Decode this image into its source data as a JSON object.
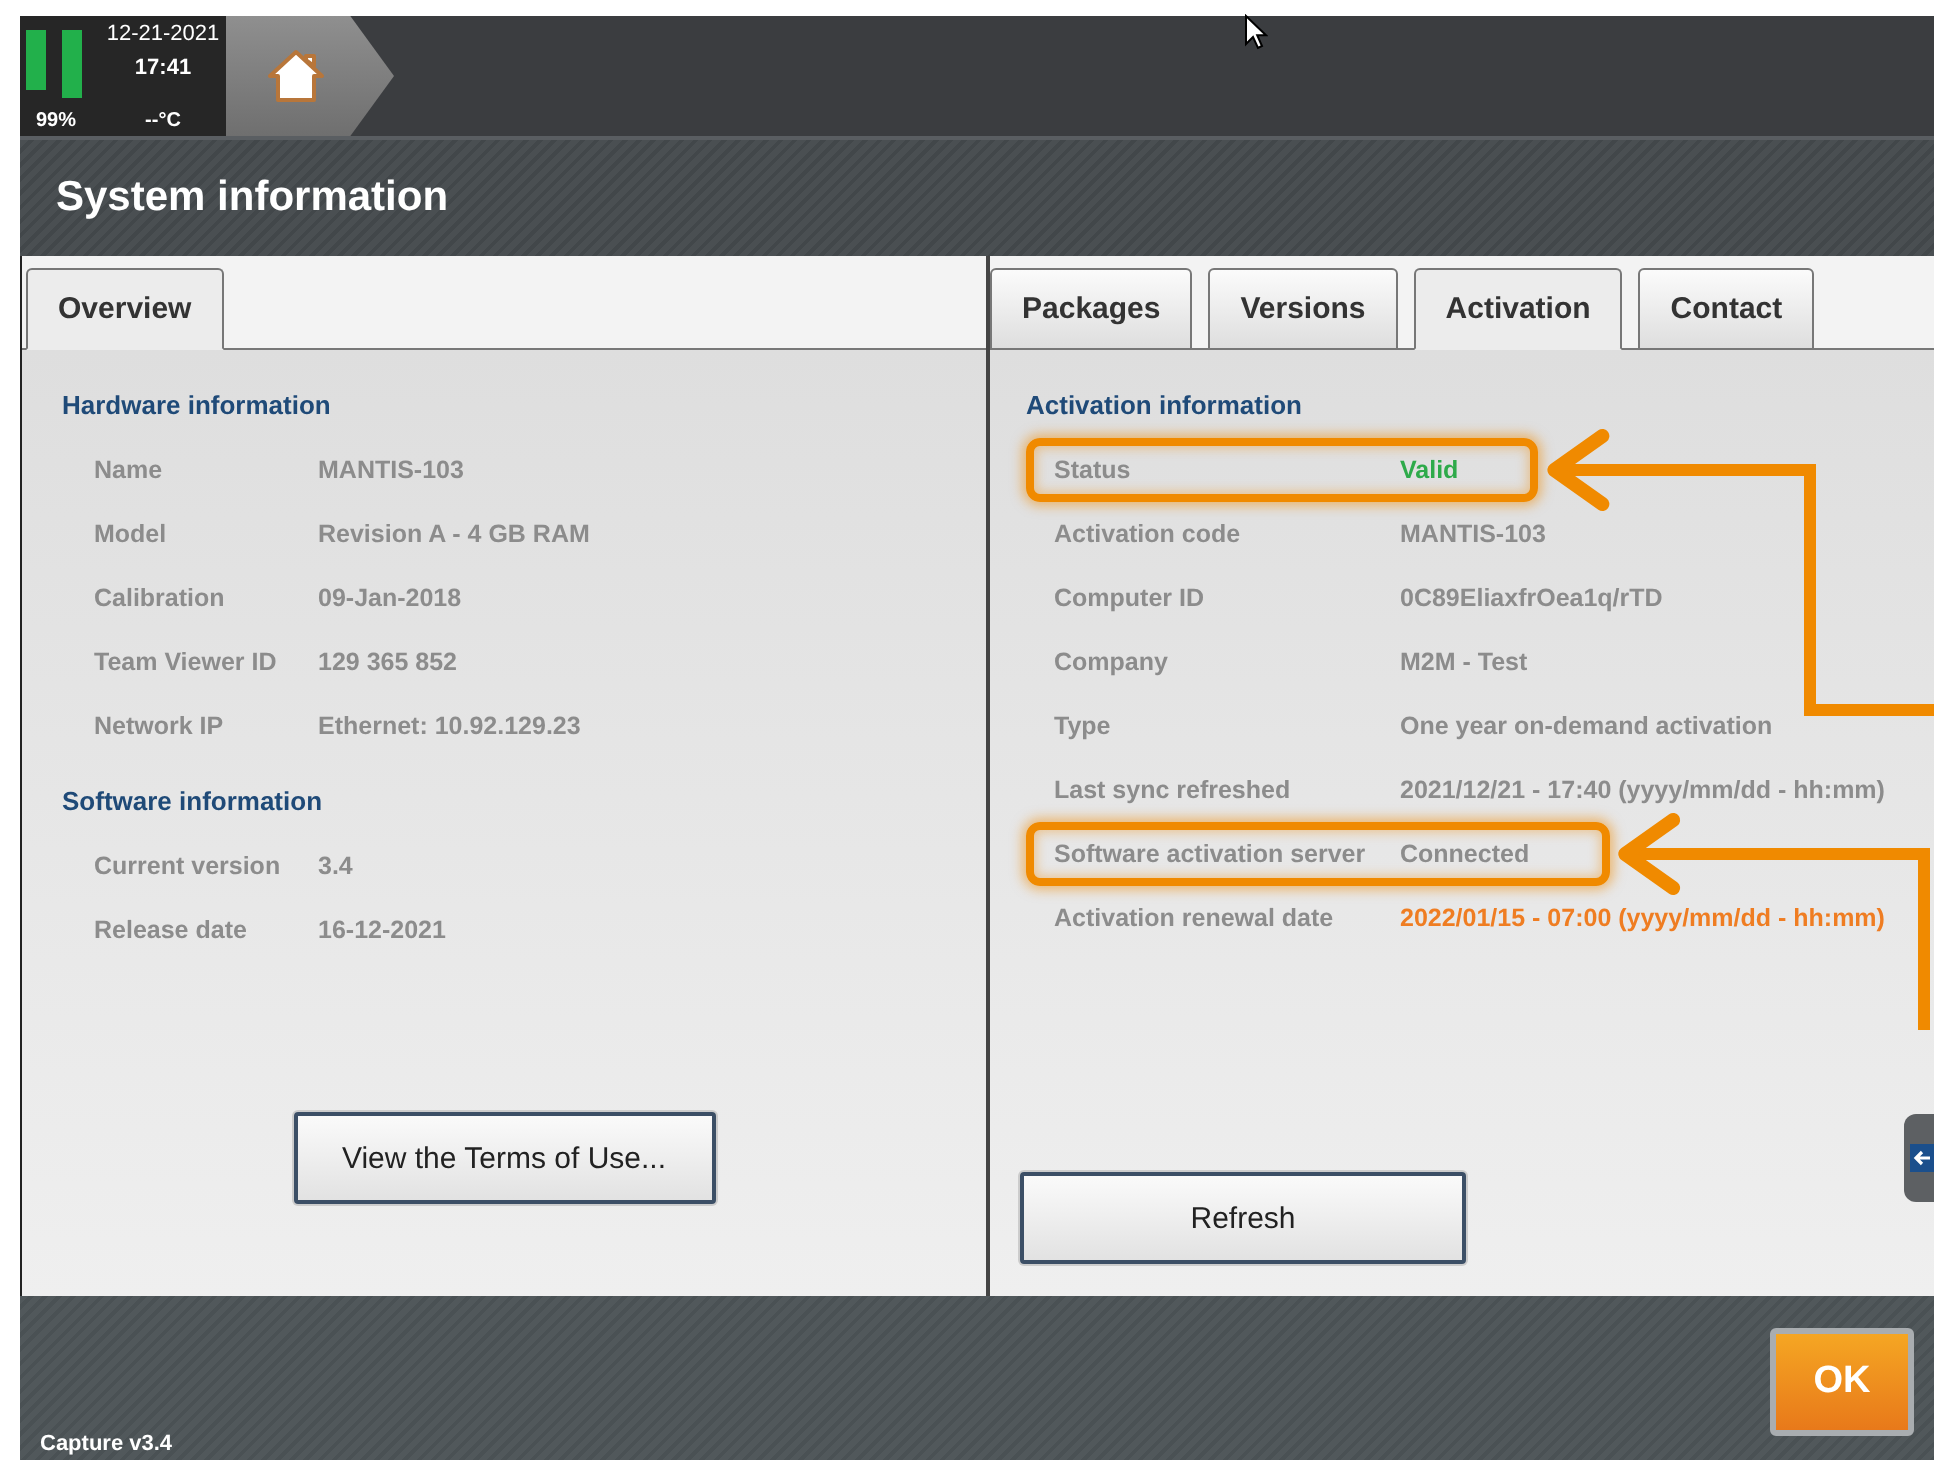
{
  "status_bar": {
    "date": "12-21-2021",
    "time": "17:41",
    "battery": "99%",
    "temperature": "--°C"
  },
  "title": "System information",
  "left_panel": {
    "tabs": [
      {
        "label": "Overview",
        "selected": true
      }
    ],
    "sections": [
      {
        "heading": "Hardware information",
        "rows": [
          {
            "label": "Name",
            "value": "MANTIS-103",
            "highlighted": false
          },
          {
            "label": "Model",
            "value": "Revision A - 4 GB RAM",
            "highlighted": false
          },
          {
            "label": "Calibration",
            "value": "09-Jan-2018",
            "highlighted": false
          },
          {
            "label": "Team Viewer ID",
            "value": "129 365 852",
            "highlighted": false
          },
          {
            "label": "Network IP",
            "value": "Ethernet: 10.92.129.23",
            "highlighted": false
          }
        ]
      },
      {
        "heading": "Software information",
        "rows": [
          {
            "label": "Current version",
            "value": "3.4",
            "highlighted": false
          },
          {
            "label": "Release date",
            "value": "16-12-2021",
            "highlighted": false
          }
        ]
      }
    ],
    "button": "View the Terms of Use..."
  },
  "right_panel": {
    "tabs": [
      {
        "label": "Packages",
        "selected": false
      },
      {
        "label": "Versions",
        "selected": false
      },
      {
        "label": "Activation",
        "selected": true
      },
      {
        "label": "Contact",
        "selected": false
      }
    ],
    "sections": [
      {
        "heading": "Activation information",
        "rows": [
          {
            "label": "Status",
            "value": "Valid",
            "color": "#2eaa4a",
            "highlighted": true
          },
          {
            "label": "Activation code",
            "value": "MANTIS-103",
            "highlighted": false
          },
          {
            "label": "Computer ID",
            "value": "0C89EliaxfrOea1q/rTD",
            "highlighted": false
          },
          {
            "label": "Company",
            "value": "M2M - Test",
            "highlighted": false
          },
          {
            "label": "Type",
            "value": "One year on-demand activation",
            "highlighted": false
          },
          {
            "label": "Last sync refreshed",
            "value": "2021/12/21 - 17:40 (yyyy/mm/dd - hh:mm)",
            "highlighted": false
          },
          {
            "label": "Software activation server",
            "value": "Connected",
            "highlighted": true
          },
          {
            "label": "Activation renewal date",
            "value": "2022/01/15 - 07:00 (yyyy/mm/dd - hh:mm)",
            "color": "#ef7d22",
            "highlighted": false
          }
        ]
      }
    ],
    "button": "Refresh"
  },
  "footer": {
    "version": "Capture v3.4",
    "ok_button": "OK"
  }
}
